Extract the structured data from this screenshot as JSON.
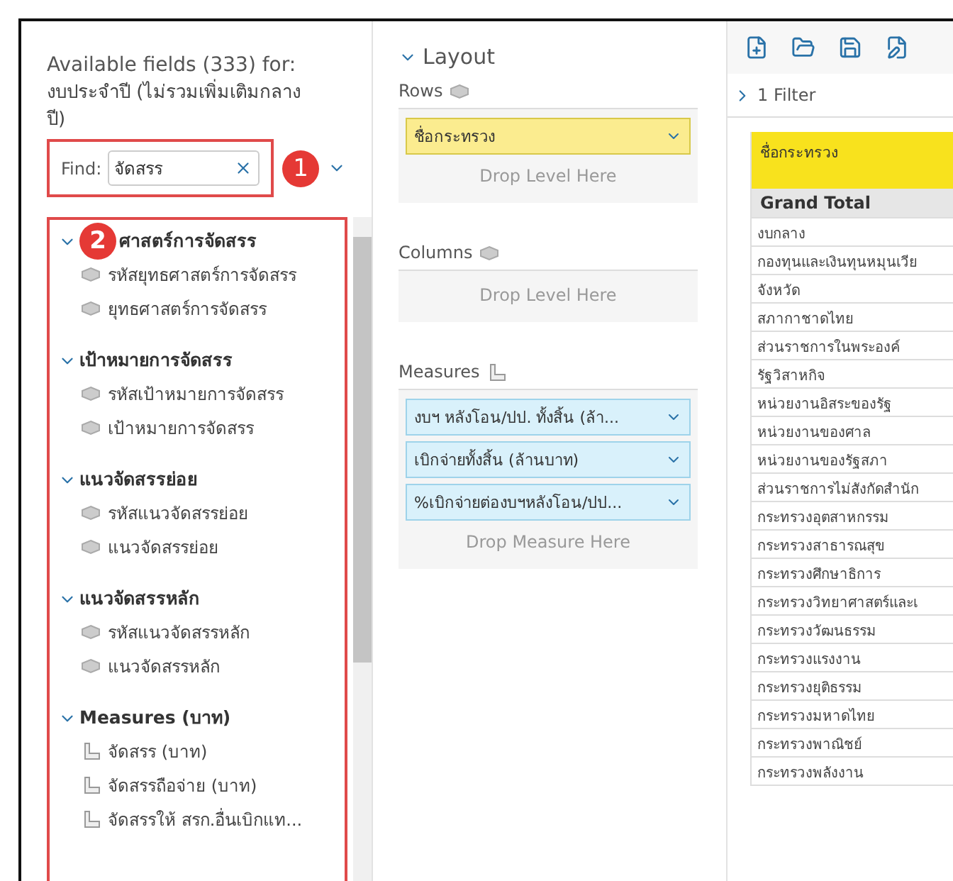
{
  "fields_panel": {
    "title": "Available fields (333) for:",
    "subtitle": "งบประจำปี (ไม่รวมเพิ่มเติมกลางปี)",
    "find_label": "Find:",
    "find_value": "จัดสรร",
    "callouts": [
      "1",
      "2"
    ],
    "groups": [
      {
        "name": "ศาสตร์การจัดสรร",
        "expanded": true,
        "items": [
          {
            "label": "รหัสยุทธศาสตร์การจัดสรร",
            "kind": "level"
          },
          {
            "label": "ยุทธศาสตร์การจัดสรร",
            "kind": "level"
          }
        ]
      },
      {
        "name": "เป้าหมายการจัดสรร",
        "expanded": true,
        "items": [
          {
            "label": "รหัสเป้าหมายการจัดสรร",
            "kind": "level"
          },
          {
            "label": "เป้าหมายการจัดสรร",
            "kind": "level"
          }
        ]
      },
      {
        "name": "แนวจัดสรรย่อย",
        "expanded": true,
        "items": [
          {
            "label": "รหัสแนวจัดสรรย่อย",
            "kind": "level"
          },
          {
            "label": "แนวจัดสรรย่อย",
            "kind": "level"
          }
        ]
      },
      {
        "name": "แนวจัดสรรหลัก",
        "expanded": true,
        "items": [
          {
            "label": "รหัสแนวจัดสรรหลัก",
            "kind": "level"
          },
          {
            "label": "แนวจัดสรรหลัก",
            "kind": "level"
          }
        ]
      },
      {
        "name": "Measures (บาท)",
        "expanded": true,
        "items": [
          {
            "label": "จัดสรร (บาท)",
            "kind": "measure"
          },
          {
            "label": "จัดสรรถือจ่าย (บาท)",
            "kind": "measure"
          },
          {
            "label": "จัดสรรให้ สรก.อื่นเบิกแท...",
            "kind": "measure"
          }
        ]
      }
    ]
  },
  "layout_panel": {
    "title": "Layout",
    "expanded": true,
    "sections": [
      {
        "name": "Rows",
        "kind": "level",
        "items": [
          "ชื่อกระทรวง"
        ],
        "drop_hint": "Drop Level Here"
      },
      {
        "name": "Columns",
        "kind": "level",
        "drop_hint": "Drop Level Here"
      },
      {
        "name": "Measures",
        "kind": "measure",
        "items": [
          "งบฯ หลังโอน/ปป. ทั้งสิ้น (ล้า...",
          "เบิกจ่ายทั้งสิ้น (ล้านบาท)",
          "%เบิกจ่ายต่องบฯหลังโอน/ปป..."
        ],
        "drop_hint": "Drop Measure Here"
      }
    ]
  },
  "report": {
    "filter": "1 Filter",
    "filter_expanded": false,
    "header": "ชื่อกระทรวง",
    "grand_total": "Grand Total",
    "rows": [
      "งบกลาง",
      "กองทุนและเงินทุนหมุนเวีย",
      "จังหวัด",
      "สภากาชาดไทย",
      "ส่วนราชการในพระองค์",
      "รัฐวิสาหกิจ",
      "หน่วยงานอิสระของรัฐ",
      "หน่วยงานของศาล",
      "หน่วยงานของรัฐสภา",
      "ส่วนราชการไม่สังกัดสำนัก",
      "กระทรวงอุตสาหกรรม",
      "กระทรวงสาธารณสุข",
      "กระทรวงศึกษาธิการ",
      "กระทรวงวิทยาศาสตร์และเ",
      "กระทรวงวัฒนธรรม",
      "กระทรวงแรงงาน",
      "กระทรวงยุติธรรม",
      "กระทรวงมหาดไทย",
      "กระทรวงพาณิชย์",
      "กระทรวงพลังงาน"
    ]
  }
}
